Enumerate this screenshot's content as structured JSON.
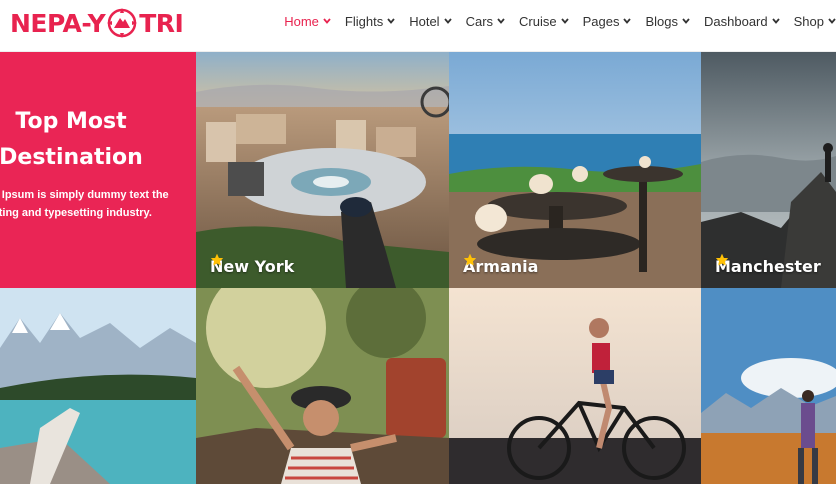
{
  "brand": {
    "name_left": "NEPA-Y",
    "name_right": "TRI",
    "accent": "#e8234f"
  },
  "nav": [
    {
      "label": "Home",
      "active": true
    },
    {
      "label": "Flights",
      "active": false
    },
    {
      "label": "Hotel",
      "active": false
    },
    {
      "label": "Cars",
      "active": false
    },
    {
      "label": "Cruise",
      "active": false
    },
    {
      "label": "Pages",
      "active": false
    },
    {
      "label": "Blogs",
      "active": false
    },
    {
      "label": "Dashboard",
      "active": false
    },
    {
      "label": "Shop",
      "active": false
    }
  ],
  "promo": {
    "title_line1": "Top Most",
    "title_line2": "Destination",
    "text_line1": "n Ipsum is simply dummy text the",
    "text_line2": "nting and typesetting industry.",
    "background": "#ea2555"
  },
  "destinations": [
    {
      "name": "New York",
      "rating": 5
    },
    {
      "name": "Armania",
      "rating": 5
    },
    {
      "name": "Manchester",
      "rating": 5
    }
  ],
  "colors": {
    "star": "#ffc107",
    "text_dark": "#333333"
  }
}
